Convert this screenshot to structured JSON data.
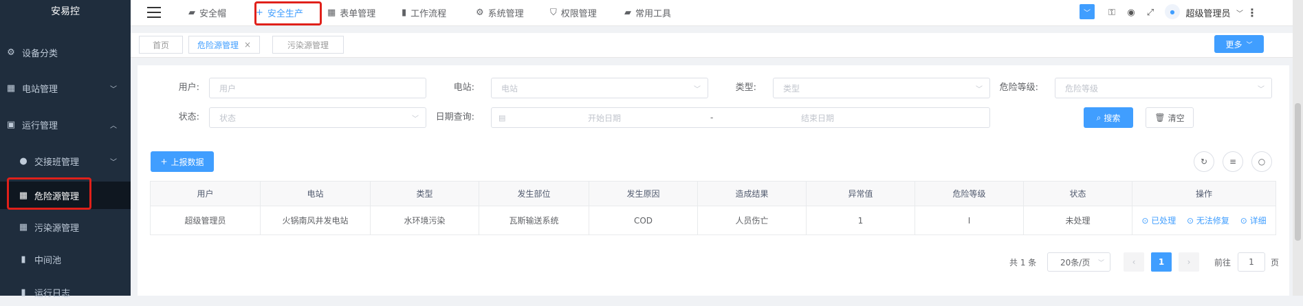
{
  "sidebar": {
    "logo": "安易控",
    "items": [
      {
        "label": "设备分类",
        "icon": "gear-icon"
      },
      {
        "label": "电站管理",
        "icon": "grid-icon"
      },
      {
        "label": "运行管理",
        "icon": "chart-icon"
      },
      {
        "label": "交接班管理",
        "icon": "user-icon"
      },
      {
        "label": "危险源管理",
        "icon": "grid-icon"
      },
      {
        "label": "污染源管理",
        "icon": "grid-icon"
      },
      {
        "label": "中间池",
        "icon": "bar-icon"
      },
      {
        "label": "运行日志",
        "icon": "bar-icon"
      }
    ]
  },
  "topnav": {
    "items": [
      {
        "label": "安全帽",
        "icon": "briefcase-icon"
      },
      {
        "label": "安全生产",
        "icon": "plus-icon"
      },
      {
        "label": "表单管理",
        "icon": "grid-icon"
      },
      {
        "label": "工作流程",
        "icon": "bar-icon"
      },
      {
        "label": "系统管理",
        "icon": "gear-icon"
      },
      {
        "label": "权限管理",
        "icon": "shield-icon"
      },
      {
        "label": "常用工具",
        "icon": "briefcase-icon"
      }
    ],
    "username": "超级管理员"
  },
  "tags": {
    "items": [
      "首页",
      "危险源管理",
      "污染源管理"
    ],
    "close": "×",
    "more": "更多"
  },
  "filters": {
    "user_label": "用户:",
    "user_placeholder": "用户",
    "station_label": "电站:",
    "station_placeholder": "电站",
    "type_label": "类型:",
    "type_placeholder": "类型",
    "level_label": "危险等级:",
    "level_placeholder": "危险等级",
    "status_label": "状态:",
    "status_placeholder": "状态",
    "date_label": "日期查询:",
    "start_placeholder": "开始日期",
    "date_sep": "-",
    "end_placeholder": "结束日期",
    "search_btn": "搜索",
    "clear_btn": "清空"
  },
  "toolbar": {
    "report_btn": "上报数据"
  },
  "table": {
    "headers": [
      "用户",
      "电站",
      "类型",
      "发生部位",
      "发生原因",
      "造成结果",
      "异常值",
      "危险等级",
      "状态",
      "操作"
    ],
    "rows": [
      {
        "cells": [
          "超级管理员",
          "火锅南风井发电站",
          "水环境污染",
          "瓦斯输送系统",
          "COD",
          "人员伤亡",
          "1",
          "I",
          "未处理"
        ],
        "ops": [
          "已处理",
          "无法修复",
          "详细"
        ]
      }
    ]
  },
  "pagination": {
    "total": "共 1 条",
    "page_size": "20条/页",
    "current": "1",
    "goto_label": "前往",
    "goto_value": "1",
    "goto_suffix": "页"
  }
}
